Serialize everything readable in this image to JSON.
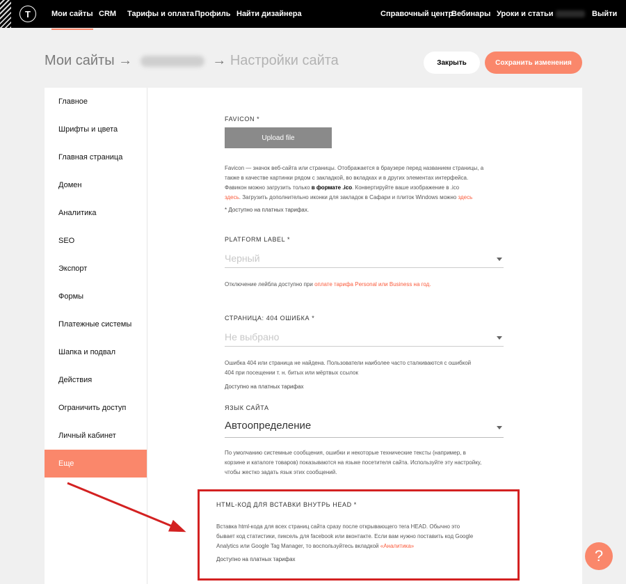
{
  "topbar": {
    "logo": "T",
    "nav": [
      "Мои сайты",
      "CRM",
      "Тарифы и оплата",
      "Профиль",
      "Найти дизайнера"
    ],
    "right": [
      "Справочный центр",
      "Вебинары",
      "Уроки и статьи"
    ],
    "logout": "Выйти"
  },
  "header": {
    "crumb_first": "Мои сайты",
    "arrow": "→",
    "crumb_last": "Настройки сайта",
    "close_label": "Закрыть",
    "save_label": "Сохранить изменения"
  },
  "sidebar": {
    "items": [
      "Главное",
      "Шрифты и цвета",
      "Главная страница",
      "Домен",
      "Аналитика",
      "SEO",
      "Экспорт",
      "Формы",
      "Платежные системы",
      "Шапка и подвал",
      "Действия",
      "Ограничить доступ",
      "Личный кабинет",
      "Еще"
    ],
    "active": "Еще"
  },
  "favicon": {
    "label": "FAVICON *",
    "button": "Upload file",
    "help1": "Favicon — значок веб-сайта или страницы. Отображается в браузере перед названием страницы, а",
    "help2": "также в качестве картинки рядом с закладкой, во вкладках и в других элементах интерфейса.",
    "help3a": "Фавикон можно загрузить только ",
    "help3b": "в формате .ico",
    "help3c": ". Конвертируйте ваше изображение в .ico",
    "help4a": "здесь",
    "help4b": ". Загрузить дополнительно иконки для закладок в Сафари и плиток Windows можно ",
    "help4c": "здесь",
    "note": "* Доступно на платных тарифах."
  },
  "platform": {
    "label": "PLATFORM LABEL *",
    "value": "Черный",
    "help_a": "Отключение лейбла доступно при ",
    "help_link": "оплате тарифа Personal или Business на год."
  },
  "page404": {
    "label": "СТРАНИЦА: 404 ОШИБКА *",
    "value": "Не выбрано",
    "help1": "Ошибка 404 или страница не найдена. Пользователи наиболее часто сталкиваются с ошибкой",
    "help2": "404 при посещении т. н. битых или мёртвых ссылок",
    "note": "Доступно на платных тарифах"
  },
  "lang": {
    "label": "ЯЗЫК САЙТА",
    "value": "Автоопределение",
    "help1": "По умолчанию системные сообщения, ошибки и некоторые технические тексты (например, в",
    "help2": "корзине и каталоге товаров) показываются на языке посетителя сайта. Используйте эту настройку,",
    "help3": "чтобы жестко задать язык этих сообщений."
  },
  "head": {
    "label": "HTML-КОД ДЛЯ ВСТАВКИ ВНУТРЬ HEAD *",
    "help1": "Вставка html-кода для всех страниц сайта сразу после открывающего тега HEAD. Обычно это",
    "help2": "бывает код статистики, пиксель для facebook или вконтакте. Если вам нужно поставить код Google",
    "help3a": "Analytics или Google Tag Manager, то воспользуйтесь вкладкой ",
    "help3link": "«Аналитика»",
    "note": "Доступно на платных тарифах"
  },
  "fab": "?",
  "colors": {
    "accent": "#fa876b",
    "annotation": "#d32121"
  }
}
